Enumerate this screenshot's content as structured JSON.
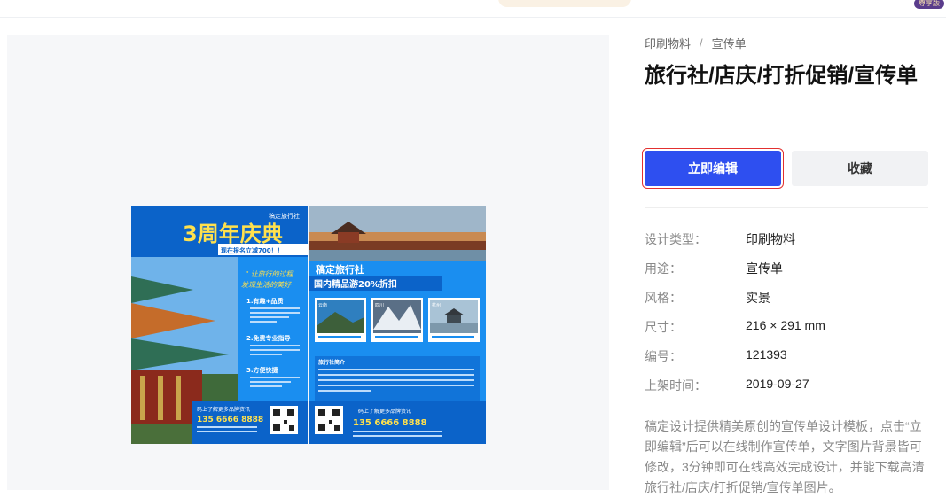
{
  "header": {
    "vip_badge": "尊享版"
  },
  "breadcrumb": {
    "category": "印刷物料",
    "separator": "/",
    "subcategory": "宣传单"
  },
  "title": "旅行社/店庆/打折促销/宣传单",
  "buttons": {
    "edit_label": "立即编辑",
    "favorite_label": "收藏"
  },
  "attributes": [
    {
      "key": "设计类型：",
      "value": "印刷物料"
    },
    {
      "key": "用途：",
      "value": "宣传单"
    },
    {
      "key": "风格：",
      "value": "实景"
    },
    {
      "key": "尺寸：",
      "value": "216 × 291 mm"
    },
    {
      "key": "编号：",
      "value": "121393"
    },
    {
      "key": "上架时间：",
      "value": "2019-09-27"
    }
  ],
  "description": "稿定设计提供精美原创的宣传单设计模板，点击“立即编辑”后可以在线制作宣传单，文字图片背景皆可修改，3分钟即可在线高效完成设计，并能下载高清旅行社/店庆/打折促销/宣传单图片。",
  "poster": {
    "left_brand": "稿定旅行社",
    "left_headline": "3周年庆典",
    "left_sub": "现在报名立减700！！",
    "slogan_1": "“ 让旅行的过程",
    "slogan_2": "发现生活的美好",
    "point_1": "1.有趣+品质",
    "point_2": "2.免费专业指导",
    "point_3": "3.方便快捷",
    "left_footer": "码上了解更多品牌资讯",
    "phone": "135 6666 8888",
    "right_brand": "稿定旅行社",
    "right_headline": "国内精品游20%折扣",
    "photo_1_tag": "云南",
    "photo_2_tag": "四川",
    "photo_3_tag": "杭州",
    "intro_title": "旅行社简介",
    "right_footer": "码上了解更多品牌资讯",
    "colors": {
      "blue": "#1a8ef0",
      "deep_blue": "#0b63c9",
      "yellow": "#ffe14d"
    }
  }
}
